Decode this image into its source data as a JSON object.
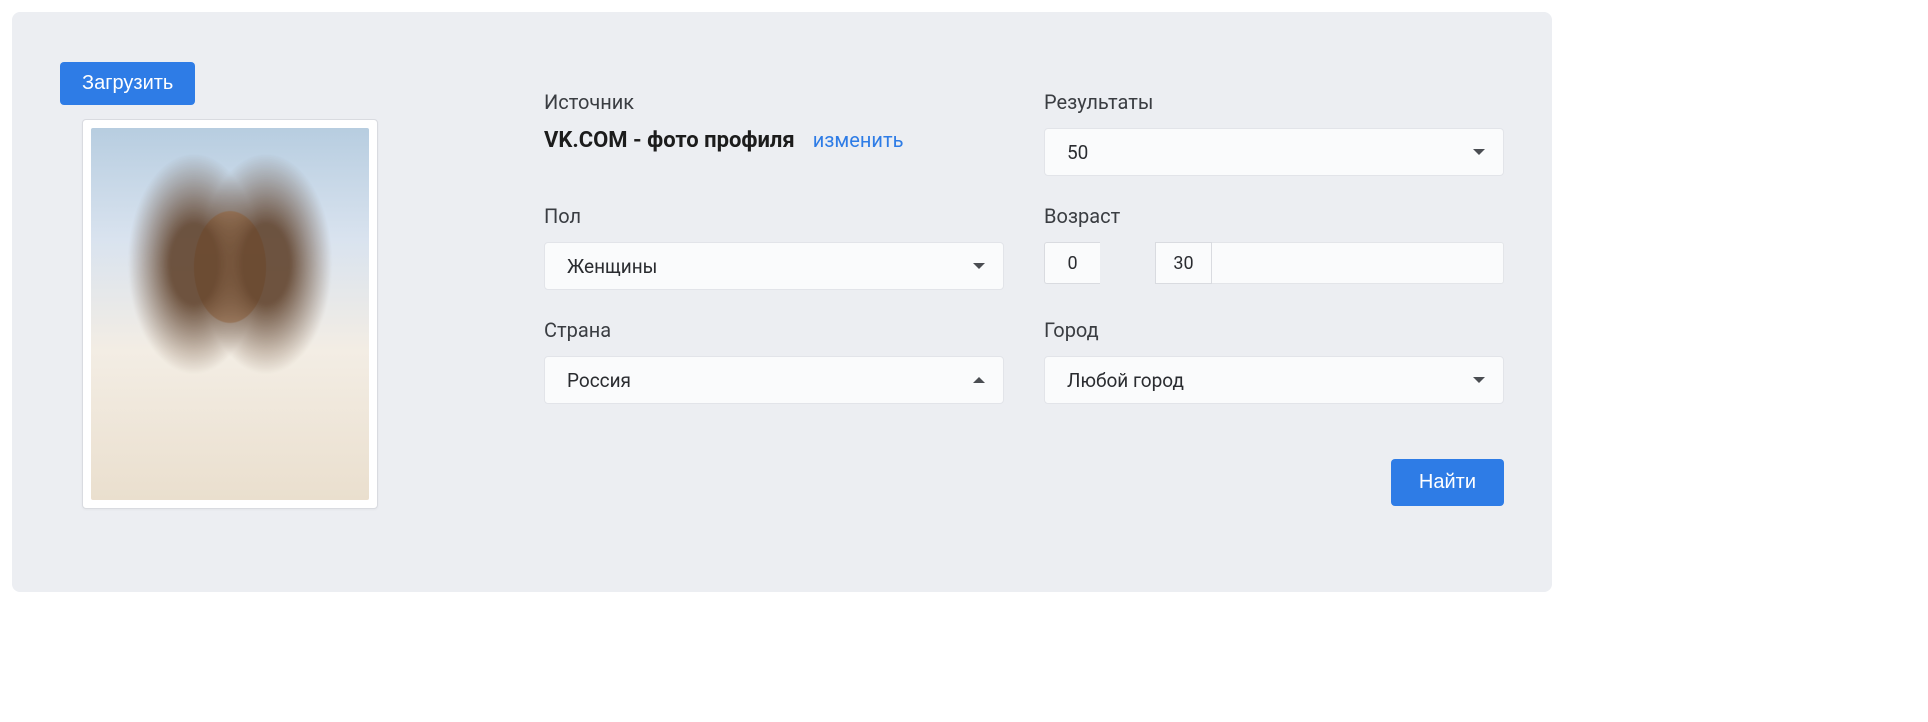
{
  "upload": {
    "label": "Загрузить"
  },
  "source": {
    "label": "Источник",
    "value": "VK.COM - фото профиля",
    "change": "изменить"
  },
  "results": {
    "label": "Результаты",
    "value": "50"
  },
  "gender": {
    "label": "Пол",
    "value": "Женщины"
  },
  "age": {
    "label": "Возраст",
    "min": "0",
    "max": "30"
  },
  "country": {
    "label": "Страна",
    "value": "Россия"
  },
  "city": {
    "label": "Город",
    "value": "Любой город"
  },
  "search": {
    "label": "Найти"
  }
}
